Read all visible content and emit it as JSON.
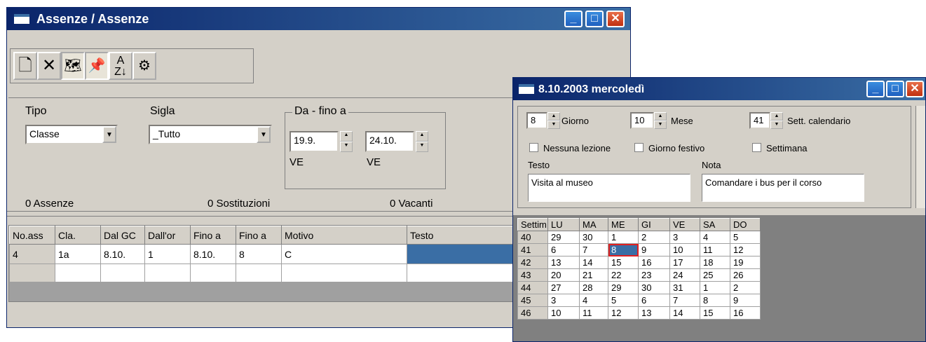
{
  "win1": {
    "title": "Assenze / Assenze",
    "tipo_label": "Tipo",
    "tipo_value": "Classe",
    "sigla_label": "Sigla",
    "sigla_value": "_Tutto",
    "range_label": "Da - fino a",
    "from_value": "19.9.",
    "to_value": "24.10.",
    "from_day": "VE",
    "to_day": "VE",
    "assenze": "0 Assenze",
    "sostituzioni": "0 Sostituzioni",
    "vacanti": "0 Vacanti",
    "columns": [
      "No.ass",
      "Cla.",
      "Dal GC",
      "Dall'or",
      "Fino a",
      "Fino a",
      "Motivo",
      "Testo"
    ],
    "rows": [
      [
        "4",
        "1a",
        "8.10.",
        "1",
        "8.10.",
        "8",
        "C",
        ""
      ]
    ]
  },
  "win2": {
    "title": "8.10.2003 mercoledì",
    "giorno_value": "8",
    "giorno_label": "Giorno",
    "mese_value": "10",
    "mese_label": "Mese",
    "sett_value": "41",
    "sett_label": "Sett. calendario",
    "nessuna": "Nessuna lezione",
    "festivo": "Giorno festivo",
    "settimana": "Settimana",
    "testo_label": "Testo",
    "testo_value": "Visita al museo",
    "nota_label": "Nota",
    "nota_value": "Comandare i bus per il corso",
    "cal_header": [
      "Settim",
      "LU",
      "MA",
      "ME",
      "GI",
      "VE",
      "SA",
      "DO"
    ],
    "cal_rows": [
      [
        "40",
        "29",
        "30",
        "1",
        "2",
        "3",
        "4",
        "5"
      ],
      [
        "41",
        "6",
        "7",
        "8",
        "9",
        "10",
        "11",
        "12"
      ],
      [
        "42",
        "13",
        "14",
        "15",
        "16",
        "17",
        "18",
        "19"
      ],
      [
        "43",
        "20",
        "21",
        "22",
        "23",
        "24",
        "25",
        "26"
      ],
      [
        "44",
        "27",
        "28",
        "29",
        "30",
        "31",
        "1",
        "2"
      ],
      [
        "45",
        "3",
        "4",
        "5",
        "6",
        "7",
        "8",
        "9"
      ],
      [
        "46",
        "10",
        "11",
        "12",
        "13",
        "14",
        "15",
        "16"
      ]
    ]
  }
}
